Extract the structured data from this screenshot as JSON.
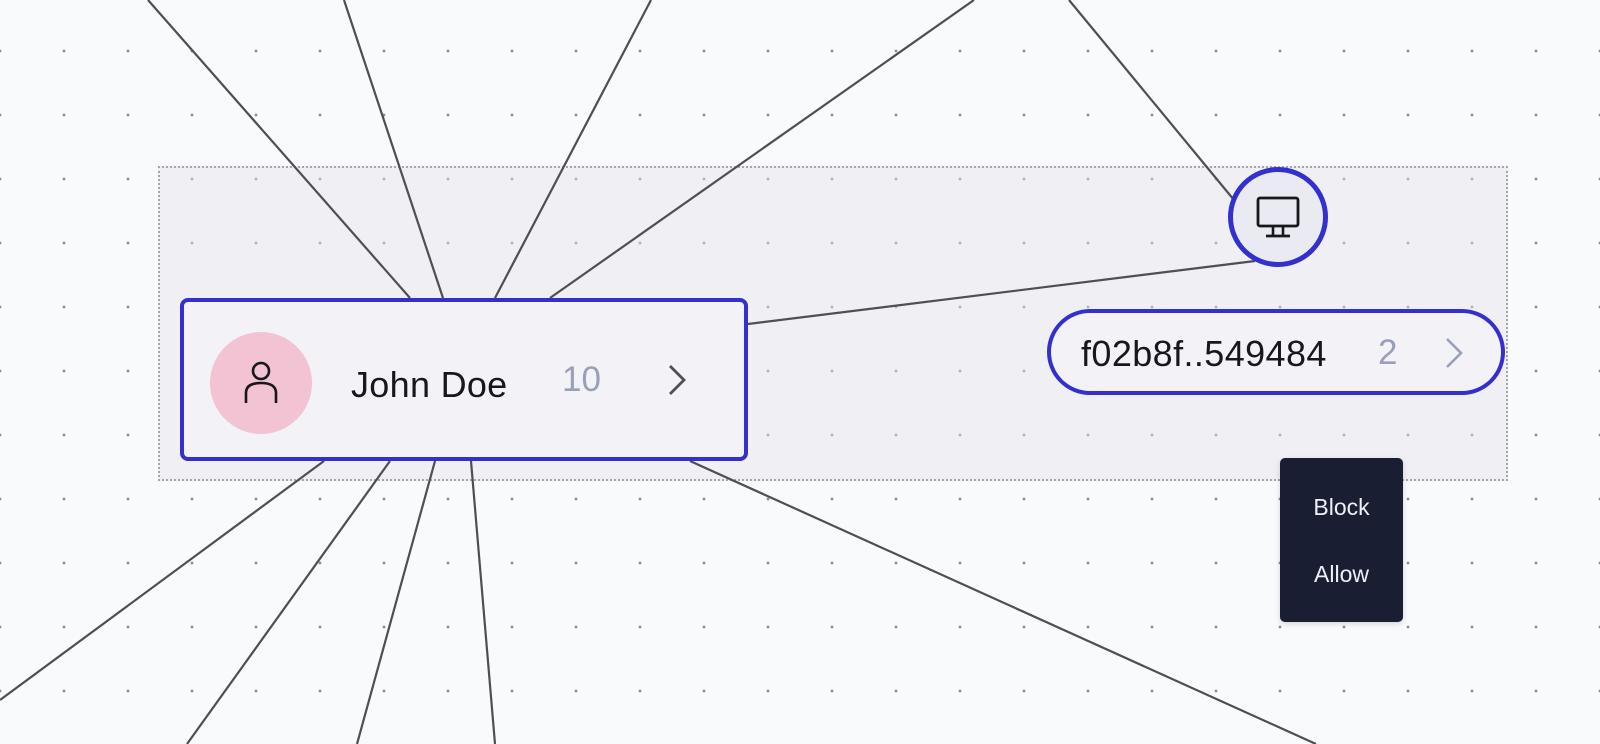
{
  "graph": {
    "selection_active": true,
    "nodes": {
      "user": {
        "type": "user",
        "name": "John Doe",
        "count": "10",
        "icon": "person-icon",
        "avatar_color": "#f2c3d3",
        "selected": true
      },
      "device": {
        "type": "device",
        "icon": "monitor-icon",
        "selected": true
      },
      "hash": {
        "type": "hash",
        "label": "f02b8f..549484",
        "count": "2",
        "selected": true
      }
    },
    "context_menu": {
      "items": [
        {
          "label": "Block"
        },
        {
          "label": "Allow"
        }
      ]
    }
  },
  "colors": {
    "accent": "#3430cf",
    "edge": "#4e4e54",
    "count_text": "#97a0b8",
    "menu_bg": "#1a1e33",
    "canvas_bg": "#f9fafc"
  }
}
